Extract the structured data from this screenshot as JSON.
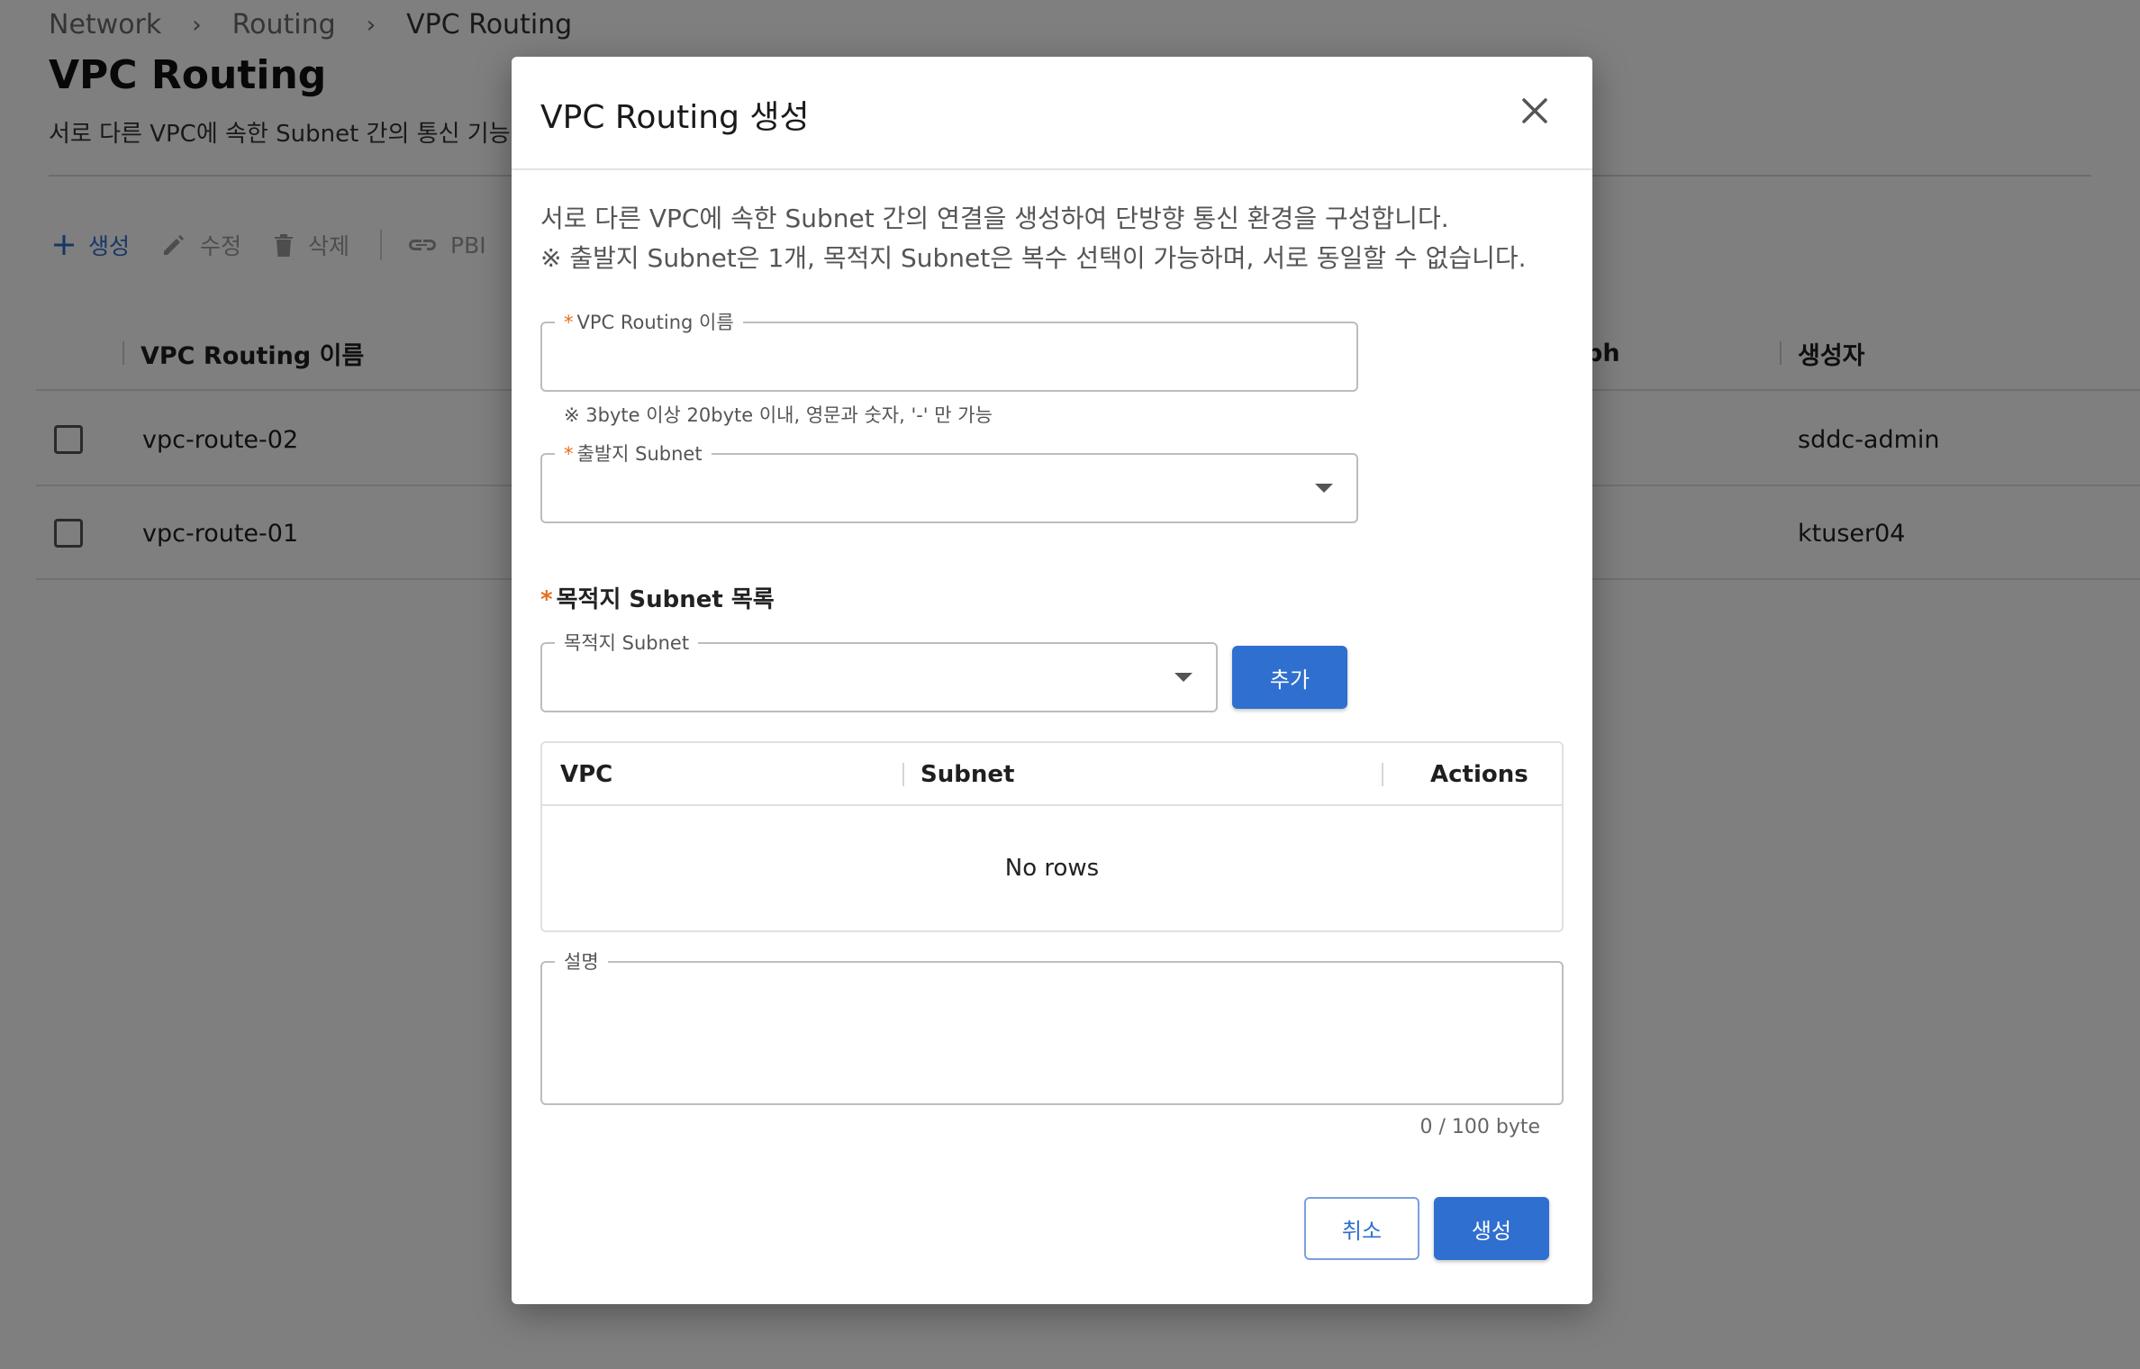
{
  "breadcrumb": {
    "items": [
      "Network",
      "Routing"
    ],
    "current": "VPC Routing"
  },
  "page": {
    "title": "VPC Routing",
    "description": "서로 다른 VPC에 속한 Subnet 간의 통신 기능을 :"
  },
  "toolbar": {
    "create_label": "생성",
    "edit_label": "수정",
    "delete_label": "삭제",
    "pbr_label": "PBI"
  },
  "table": {
    "columns": [
      "VPC Routing 이름",
      "ph",
      "생성자"
    ],
    "rows": [
      {
        "name": "vpc-route-02",
        "creator": "sddc-admin"
      },
      {
        "name": "vpc-route-01",
        "creator": "ktuser04"
      }
    ]
  },
  "modal": {
    "title": "VPC Routing 생성",
    "info_line1": "서로 다른 VPC에 속한 Subnet 간의 연결을 생성하여 단방향 통신 환경을 구성합니다.",
    "info_line2": "※ 출발지 Subnet은 1개, 목적지 Subnet은 복수 선택이 가능하며, 서로 동일할 수 없습니다.",
    "name_field": {
      "label": "VPC Routing 이름",
      "value": "",
      "hint": "※ 3byte 이상 20byte 이내, 영문과 숫자, '-' 만 가능"
    },
    "source_field": {
      "label": "출발지 Subnet",
      "value": ""
    },
    "dest_section_label": "목적지 Subnet 목록",
    "dest_field": {
      "label": "목적지 Subnet",
      "value": ""
    },
    "add_label": "추가",
    "grid": {
      "columns": [
        "VPC",
        "Subnet",
        "Actions"
      ],
      "empty_text": "No rows"
    },
    "description_field": {
      "label": "설명",
      "value": "",
      "counter": "0 / 100 byte"
    },
    "cancel_label": "취소",
    "submit_label": "생성"
  },
  "colors": {
    "primary": "#2f6fcf",
    "required": "#e4701e",
    "overlay": "rgba(0,0,0,0.5)"
  }
}
